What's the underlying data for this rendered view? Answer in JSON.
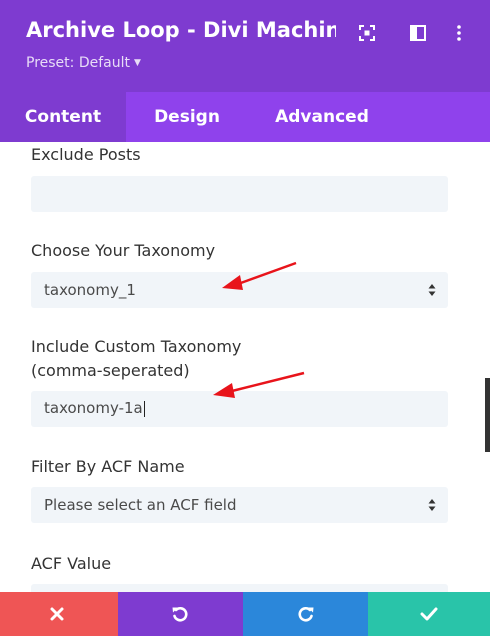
{
  "header": {
    "title": "Archive Loop - Divi Machin...",
    "preset_label": "Preset: Default",
    "icons": [
      "focus-icon",
      "sidebar-toggle-icon",
      "more-vertical-icon"
    ],
    "color": "#7e3bd0"
  },
  "tabs": [
    {
      "label": "Content",
      "active": true
    },
    {
      "label": "Design",
      "active": false
    },
    {
      "label": "Advanced",
      "active": false
    }
  ],
  "form": {
    "exclude_posts": {
      "label": "Exclude Posts",
      "value": ""
    },
    "choose_taxonomy": {
      "label": "Choose Your Taxonomy",
      "value": "taxonomy_1"
    },
    "include_custom_taxonomy": {
      "label_line1": "Include Custom Taxonomy",
      "label_line2": "(comma-seperated)",
      "value": "taxonomy-1a"
    },
    "filter_by_acf": {
      "label": "Filter By ACF Name",
      "value": "Please select an ACF field"
    },
    "acf_value": {
      "label": "ACF Value",
      "value": ""
    }
  },
  "footer": {
    "buttons": [
      {
        "name": "discard",
        "icon": "close-icon",
        "color": "#ef5555"
      },
      {
        "name": "undo",
        "icon": "undo-icon",
        "color": "#7e3bd0"
      },
      {
        "name": "redo",
        "icon": "redo-icon",
        "color": "#2b87da"
      },
      {
        "name": "save",
        "icon": "check-icon",
        "color": "#29c4a9"
      }
    ]
  },
  "annotations": {
    "arrow_color": "#e8141b"
  }
}
